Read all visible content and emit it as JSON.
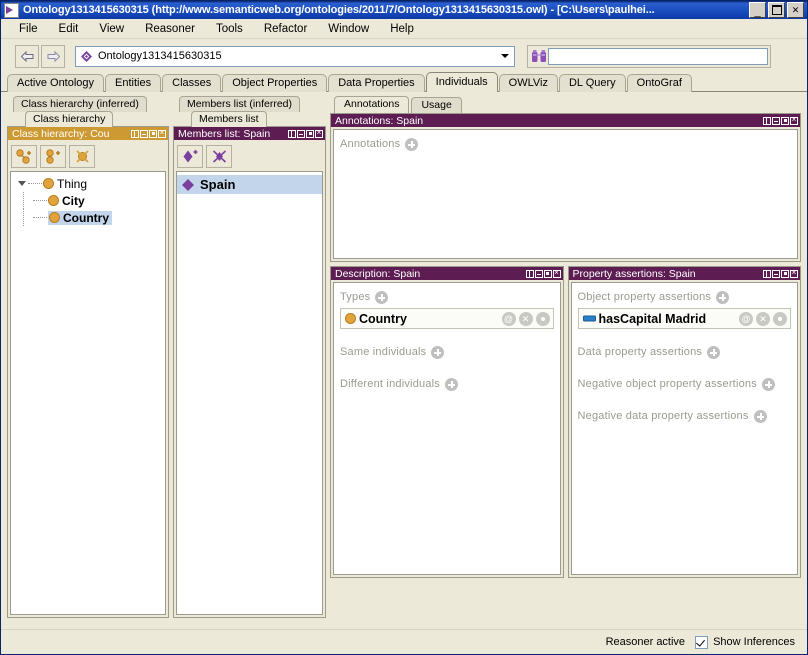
{
  "window": {
    "title": "Ontology1313415630315 (http://www.semanticweb.org/ontologies/2011/7/Ontology1313415630315.owl) - [C:\\Users\\paulhei...",
    "icon": "protege-icon",
    "minimize_label": "_",
    "maximize_label": "",
    "close_label": "×"
  },
  "menubar": {
    "items": [
      {
        "label": "File"
      },
      {
        "label": "Edit"
      },
      {
        "label": "View"
      },
      {
        "label": "Reasoner"
      },
      {
        "label": "Tools"
      },
      {
        "label": "Refactor"
      },
      {
        "label": "Window"
      },
      {
        "label": "Help"
      }
    ]
  },
  "toolbar": {
    "back_icon": "back-arrow-icon",
    "forward_icon": "forward-arrow-icon",
    "ontology_icon": "ontology-diamond-icon",
    "ontology_label": "Ontology1313415630315",
    "dropdown_icon": "chevron-down-icon",
    "search_icon": "binoculars-search-icon",
    "search_value": "",
    "search_placeholder": ""
  },
  "main_tabs": {
    "active": "Individuals",
    "items": [
      {
        "label": "Active Ontology"
      },
      {
        "label": "Entities"
      },
      {
        "label": "Classes"
      },
      {
        "label": "Object Properties"
      },
      {
        "label": "Data Properties"
      },
      {
        "label": "Individuals"
      },
      {
        "label": "OWLViz"
      },
      {
        "label": "DL Query"
      },
      {
        "label": "OntoGraf"
      }
    ]
  },
  "class_panel": {
    "tab_inferred": "Class hierarchy (inferred)",
    "tab_active": "Class hierarchy",
    "header_title": "Class hierarchy: Cou",
    "header_color": "#cc9933",
    "toolbar_buttons": [
      {
        "name": "add-subclass-button",
        "icon": "add-subclass-icon"
      },
      {
        "name": "add-sibling-class-button",
        "icon": "add-sibling-class-icon"
      },
      {
        "name": "delete-class-button",
        "icon": "delete-class-icon"
      }
    ],
    "tree": [
      {
        "label": "Thing",
        "level": 0,
        "expanded": true,
        "selected": false,
        "bold": false
      },
      {
        "label": "City",
        "level": 1,
        "expanded": false,
        "selected": false,
        "bold": true
      },
      {
        "label": "Country",
        "level": 1,
        "expanded": false,
        "selected": true,
        "bold": true
      }
    ]
  },
  "members_panel": {
    "tab_inferred": "Members list (inferred)",
    "tab_active": "Members list",
    "header_title": "Members list: Spain",
    "toolbar_buttons": [
      {
        "name": "add-individual-button",
        "icon": "add-individual-icon"
      },
      {
        "name": "delete-individual-button",
        "icon": "delete-individual-icon"
      }
    ],
    "items": [
      {
        "label": "Spain",
        "icon": "individual-diamond-icon",
        "selected": true
      }
    ]
  },
  "annotations_panel": {
    "tabs": [
      {
        "label": "Annotations",
        "active": true
      },
      {
        "label": "Usage",
        "active": false
      }
    ],
    "header_title": "Annotations: Spain",
    "section_label": "Annotations",
    "add_icon": "plus-circle-icon"
  },
  "description_panel": {
    "header_title": "Description: Spain",
    "sections": [
      {
        "label": "Types",
        "add_icon": "plus-circle-icon"
      },
      {
        "label": "Same individuals",
        "add_icon": "plus-circle-icon"
      },
      {
        "label": "Different individuals",
        "add_icon": "plus-circle-icon"
      }
    ],
    "types_entry": {
      "icon": "class-circle-icon",
      "text": "Country",
      "buttons": [
        {
          "name": "annotate-button",
          "glyph": "@"
        },
        {
          "name": "remove-button",
          "glyph": "×"
        },
        {
          "name": "edit-button",
          "glyph": "dot"
        }
      ]
    }
  },
  "property_assertions_panel": {
    "header_title": "Property assertions: Spain",
    "sections": [
      {
        "label": "Object property assertions",
        "add_icon": "plus-circle-icon"
      },
      {
        "label": "Data property assertions",
        "add_icon": "plus-circle-icon"
      },
      {
        "label": "Negative object property assertions",
        "add_icon": "plus-circle-icon"
      },
      {
        "label": "Negative data property assertions",
        "add_icon": "plus-circle-icon"
      }
    ],
    "object_entry": {
      "icon": "object-property-icon",
      "text": "hasCapital  Madrid",
      "buttons": [
        {
          "name": "annotate-button",
          "glyph": "@"
        },
        {
          "name": "remove-button",
          "glyph": "×"
        },
        {
          "name": "edit-button",
          "glyph": "dot"
        }
      ]
    }
  },
  "statusbar": {
    "reasoner_status": "Reasoner active",
    "show_inferences_label": "Show Inferences",
    "show_inferences_checked": true
  }
}
